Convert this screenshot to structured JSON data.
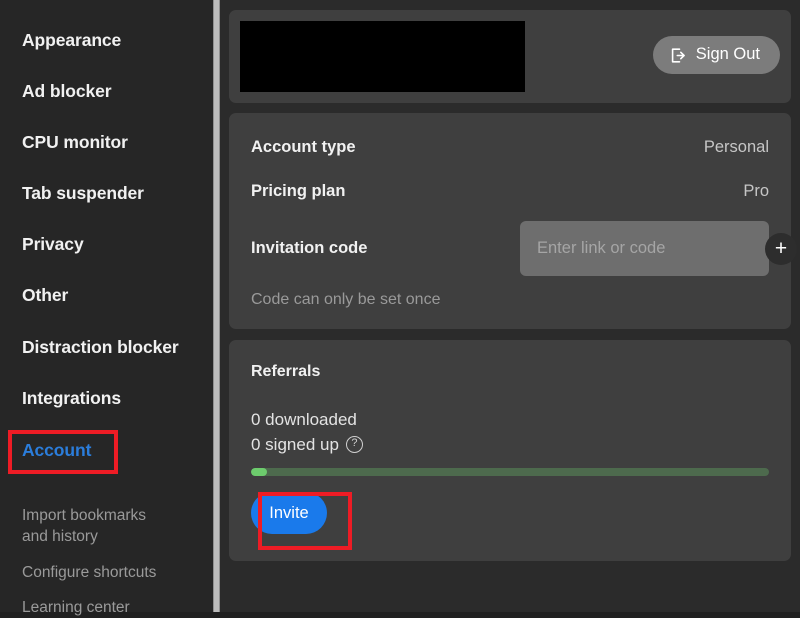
{
  "colors": {
    "panel_bg": "#2b2b2b",
    "sidebar_bg": "#262626",
    "card_bg": "#3f3f3f",
    "accent_blue": "#1a7aeb",
    "active_nav_blue": "#2b7ddb",
    "annotation_red": "#ee1c25",
    "progress_fill_green": "#6dcc6d",
    "progress_track_green": "#4d6a4d",
    "signout_gray": "#7c7c7c",
    "input_gray": "#6e6e6e"
  },
  "sidebar": {
    "items": [
      {
        "label": "Appearance",
        "active": false
      },
      {
        "label": "Ad blocker",
        "active": false
      },
      {
        "label": "CPU monitor",
        "active": false
      },
      {
        "label": "Tab suspender",
        "active": false
      },
      {
        "label": "Privacy",
        "active": false
      },
      {
        "label": "Other",
        "active": false
      },
      {
        "label": "Distraction blocker",
        "active": false
      },
      {
        "label": "Integrations",
        "active": false
      },
      {
        "label": "Account",
        "active": true
      }
    ],
    "sub_items": [
      {
        "label": "Import bookmarks\nand history"
      },
      {
        "label": "Configure shortcuts"
      },
      {
        "label": "Learning center"
      }
    ]
  },
  "profile_card": {
    "redacted_placeholder": "",
    "sign_out_label": "Sign Out",
    "sign_out_icon": "sign-out-icon"
  },
  "details_card": {
    "rows": [
      {
        "label": "Account type",
        "value": "Personal"
      },
      {
        "label": "Pricing plan",
        "value": "Pro"
      }
    ],
    "invitation_label": "Invitation code",
    "invitation_placeholder": "Enter link or code",
    "invitation_value": "",
    "add_button_glyph": "+",
    "note": "Code can only be set once"
  },
  "referrals_card": {
    "title": "Referrals",
    "downloaded": "0 downloaded",
    "signed_up": "0 signed up",
    "help_glyph": "?",
    "progress_percent": 3,
    "invite_label": "Invite"
  }
}
